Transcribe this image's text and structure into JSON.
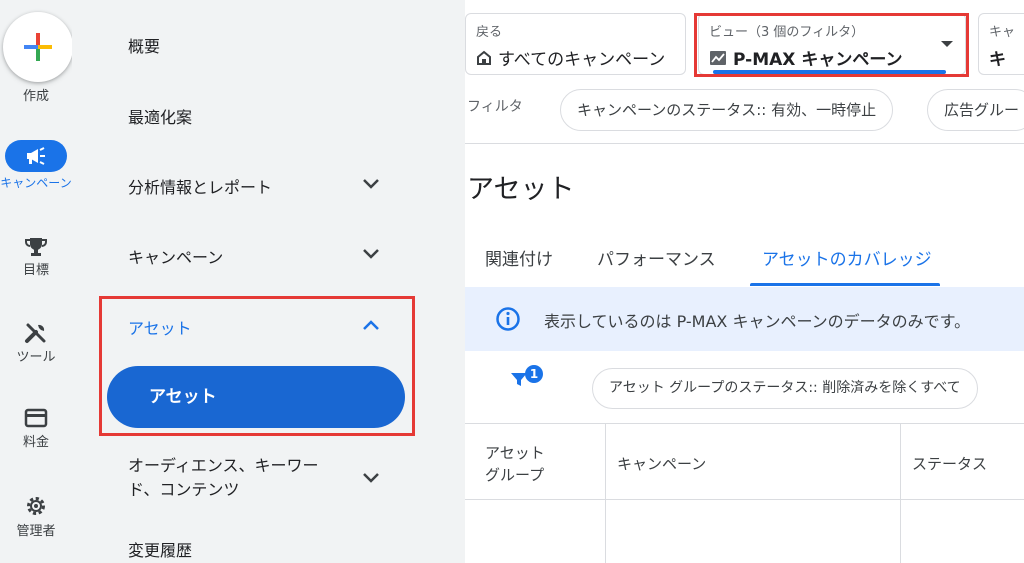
{
  "rail": {
    "create_label": "作成",
    "items": [
      {
        "label": "キャンペーン",
        "icon": "megaphone-icon",
        "active": true
      },
      {
        "label": "目標",
        "icon": "trophy-icon"
      },
      {
        "label": "ツール",
        "icon": "tools-icon"
      },
      {
        "label": "料金",
        "icon": "billing-card-icon"
      },
      {
        "label": "管理者",
        "icon": "gear-icon"
      }
    ]
  },
  "nav": {
    "items": [
      {
        "label": "概要"
      },
      {
        "label": "最適化案"
      },
      {
        "label": "分析情報とレポート",
        "expandable": true
      },
      {
        "label": "キャンペーン",
        "expandable": true
      },
      {
        "label": "アセット",
        "expanded": true
      },
      {
        "label": "オーディエンス、キーワード、コンテンツ",
        "expandable": true
      },
      {
        "label": "変更履歴"
      }
    ],
    "asset_sub_item": "アセット"
  },
  "header": {
    "back": {
      "small_label": "戻る",
      "value": "すべてのキャンペーン"
    },
    "view": {
      "small_label": "ビュー（3 個のフィルタ）",
      "value": "P-MAX キャンペーン"
    },
    "third": {
      "small_label": "キャ",
      "value": "キ"
    }
  },
  "filters": {
    "label": "フィルタ",
    "chips": [
      "キャンペーンのステータス:: 有効、一時停止",
      "広告グルー"
    ]
  },
  "page": {
    "title": "アセット",
    "tabs": [
      {
        "label": "関連付け",
        "active": false
      },
      {
        "label": "パフォーマンス",
        "active": false
      },
      {
        "label": "アセットのカバレッジ",
        "active": true
      }
    ],
    "info_text": "表示しているのは P-MAX キャンペーンのデータのみです。",
    "filter_badge": "1",
    "asset_filter_chip": "アセット グループのステータス:: 削除済みを除くすべて",
    "table": {
      "headers": [
        "アセット\nグループ",
        "キャンペーン",
        "ステータス"
      ]
    }
  },
  "colors": {
    "accent": "#1a73e8",
    "highlight": "#e53935",
    "panel_bg": "#f1f3f4"
  }
}
